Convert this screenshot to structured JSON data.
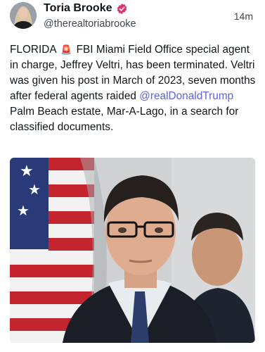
{
  "author": {
    "display_name": "Toria Brooke",
    "handle": "@therealtoriabrooke",
    "verified_icon": "verified-badge-icon",
    "avatar_icon": "profile-avatar"
  },
  "timestamp": "14m",
  "post": {
    "prefix": "FLORIDA ",
    "emoji": "🚨",
    "text_part1": " FBI Miami Field Office special agent in charge, Jeffrey Veltri, has been terminated. Veltri was given his post in March of 2023, seven months after federal agents raided ",
    "mention": "@realDonaldTrump",
    "text_part2": " Palm Beach estate, Mar-A-Lago, in a search for classified documents."
  },
  "colors": {
    "mention": "#5b63e0",
    "verified": "#e1306c",
    "text": "#0f1419",
    "secondary": "#3f4650"
  }
}
